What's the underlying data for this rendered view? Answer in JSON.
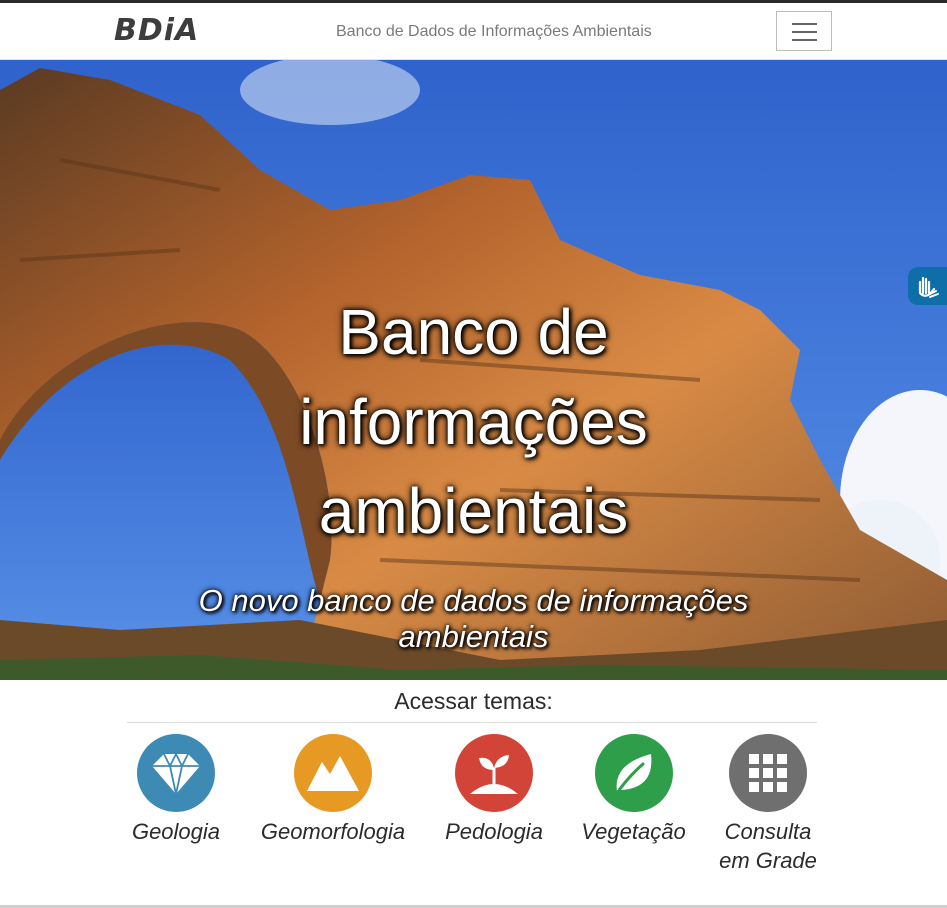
{
  "navbar": {
    "logo": "BDiA",
    "title": "Banco de Dados de Informações Ambientais",
    "menu_icon": "hamburger-menu-icon"
  },
  "hero": {
    "title": "Banco de informações ambientais",
    "subtitle": "O novo banco de dados de informações ambientais"
  },
  "accessibility": {
    "icon": "sign-language-hands-icon"
  },
  "themes": {
    "label": "Acessar temas:",
    "items": [
      {
        "label": "Geologia",
        "icon": "diamond-icon",
        "color": "#3d8ab5"
      },
      {
        "label": "Geomorfologia",
        "icon": "mountains-icon",
        "color": "#e69a24"
      },
      {
        "label": "Pedologia",
        "icon": "sprout-soil-icon",
        "color": "#d24437"
      },
      {
        "label": "Vegetação",
        "icon": "leaf-icon",
        "color": "#2e9e4a"
      },
      {
        "label": "Consulta em Grade",
        "icon": "grid-icon",
        "color": "#6f6f6f"
      }
    ]
  }
}
